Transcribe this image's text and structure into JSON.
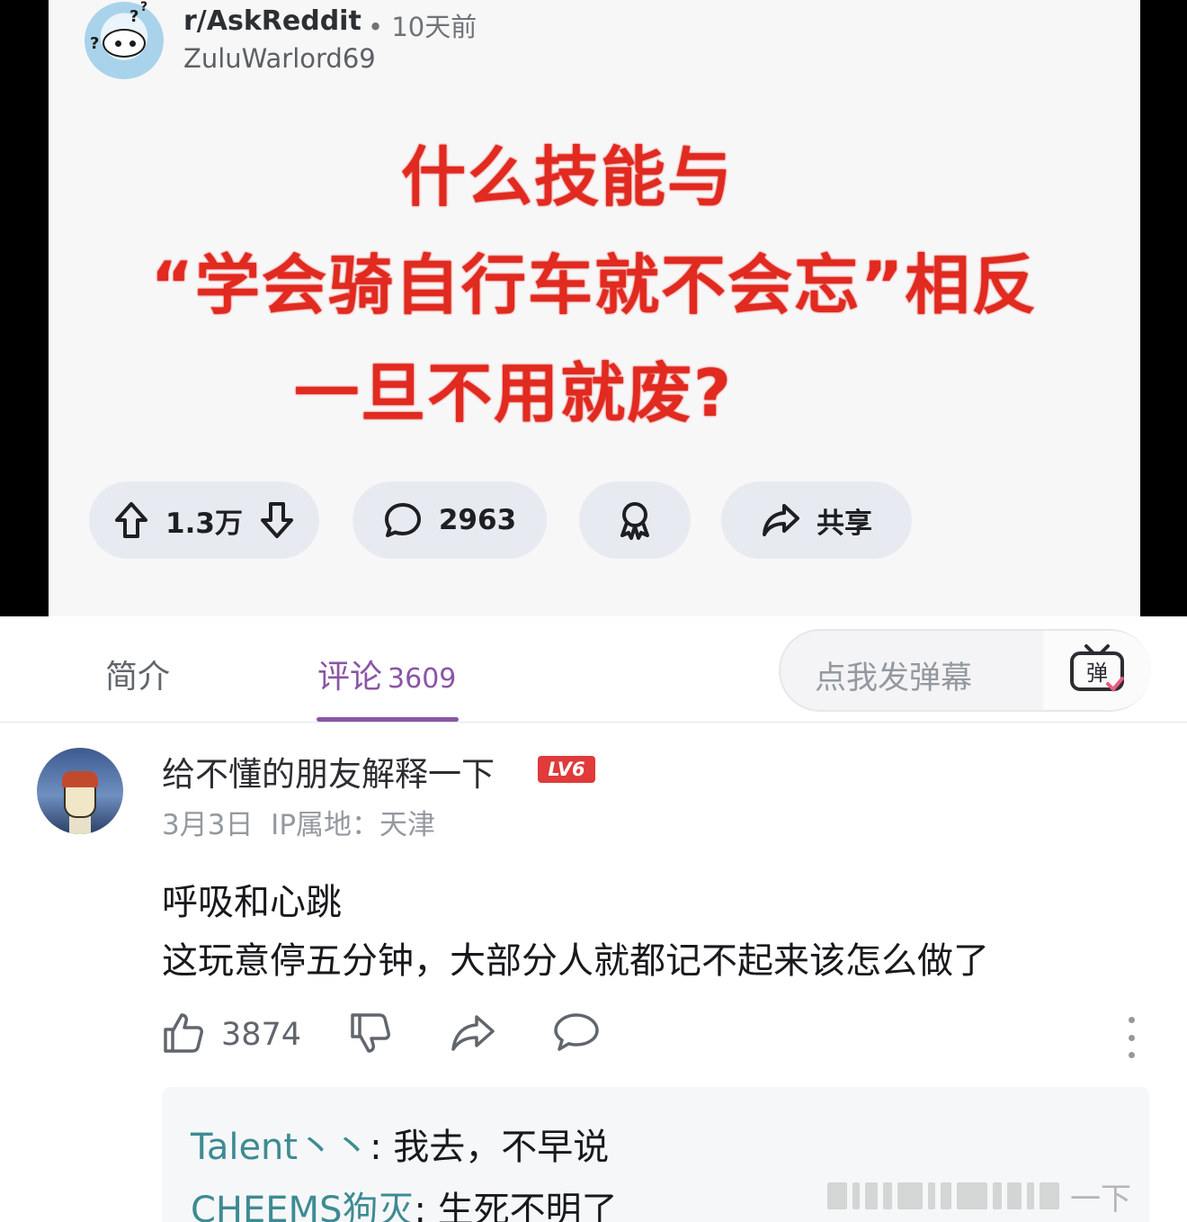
{
  "post": {
    "subreddit": "r/AskReddit",
    "time": "10天前",
    "author": "ZuluWarlord69",
    "title_lines": [
      "什么技能与",
      "“学会骑自行车就不会忘”相反",
      "一旦不用就废?"
    ],
    "votes": "1.3万",
    "comments": "2963",
    "share_label": "共享"
  },
  "tabs": {
    "intro": "简介",
    "comments_label": "评论",
    "comments_count": "3609"
  },
  "danmaku": {
    "placeholder": "点我发弹幕",
    "button_label": "弹"
  },
  "comment": {
    "username": "给不懂的朋友解释一下",
    "level": "LV6",
    "date": "3月3日",
    "ip": "IP属地：天津",
    "lines": [
      "呼吸和心跳",
      "这玩意停五分钟，大部分人就都记不起来该怎么做了"
    ],
    "likes": "3874"
  },
  "replies": [
    {
      "name": "Talent丶丶",
      "text": "我去，不早说"
    },
    {
      "name": "CHEEMS狗灭",
      "text": "生死不明了"
    }
  ],
  "watermark": {
    "text": "一下"
  },
  "colors": {
    "headline_red": "#e12a20",
    "tab_active": "#8a55a5",
    "reply_name": "#3d8b93",
    "level_badge": "#e03a3a"
  },
  "icons": [
    "upvote-icon",
    "downvote-icon",
    "comment-bubble-icon",
    "award-icon",
    "share-arrow-icon",
    "danmaku-tv-icon",
    "thumb-up-icon",
    "thumb-down-icon",
    "share-icon",
    "reply-bubble-icon",
    "more-vertical-icon"
  ]
}
